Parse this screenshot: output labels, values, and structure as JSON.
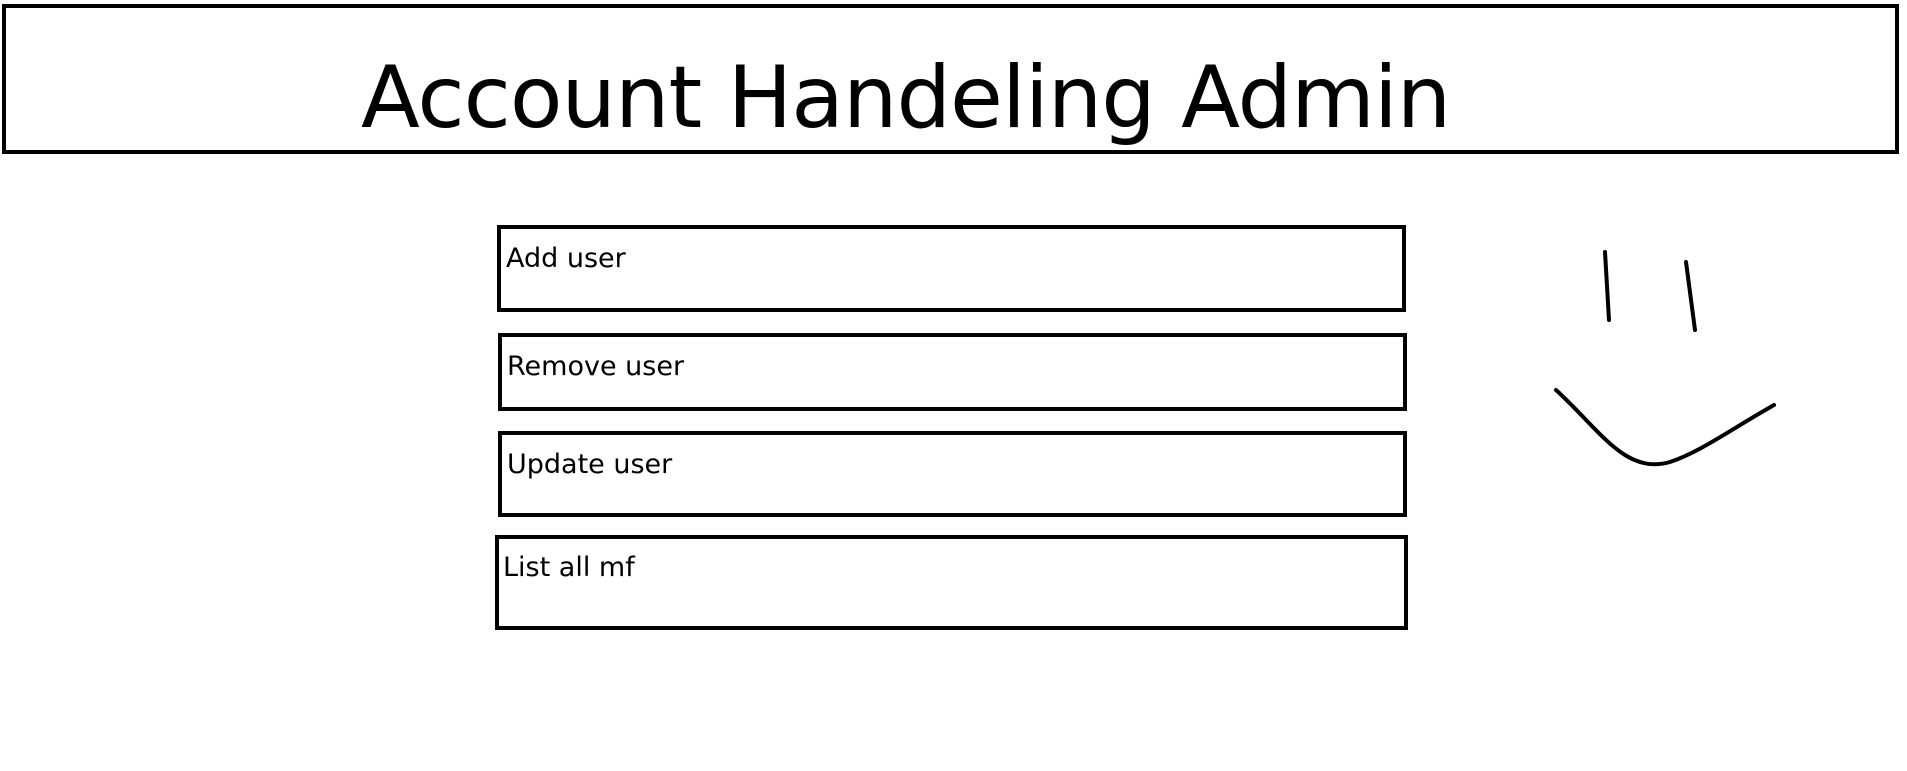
{
  "header": {
    "title": "Account Handeling Admin"
  },
  "menu": {
    "items": [
      {
        "id": "add",
        "label": "Add user"
      },
      {
        "id": "remove",
        "label": "Remove user"
      },
      {
        "id": "update",
        "label": "Update user"
      },
      {
        "id": "list",
        "label": "List all mf"
      }
    ]
  },
  "decoration": {
    "icon": "smiley-face-icon"
  }
}
